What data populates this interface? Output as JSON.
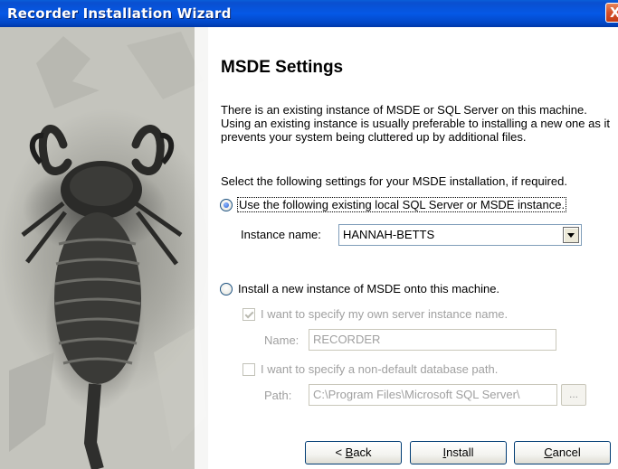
{
  "window": {
    "title": "Recorder Installation Wizard",
    "close_glyph": "X"
  },
  "page": {
    "heading": "MSDE Settings",
    "description": "There is an existing instance of MSDE or SQL Server on this machine.  Using an existing instance is usually preferable to installing a new one as it prevents your system being cluttered up by additional files.",
    "select_prompt": "Select the following settings for your MSDE installation, if required."
  },
  "option_existing": {
    "label": "Use the following existing local SQL Server or MSDE instance.",
    "selected": true,
    "instance_label": "Instance name:",
    "instance_value": "HANNAH-BETTS"
  },
  "option_new": {
    "label": "Install a new instance of MSDE onto this machine.",
    "selected": false,
    "specify_name_label": "I want to specify my own server instance name.",
    "specify_name_checked": true,
    "name_label": "Name:",
    "name_value": "RECORDER",
    "specify_path_label": "I want to specify a non-default database path.",
    "specify_path_checked": false,
    "path_label": "Path:",
    "path_value": "C:\\Program Files\\Microsoft SQL Server\\",
    "browse_label": "..."
  },
  "buttons": {
    "back_mnemonic": "B",
    "back_rest": "ack",
    "back_prefix": "< ",
    "install_mnemonic": "I",
    "install_rest": "nstall",
    "cancel_mnemonic": "C",
    "cancel_rest": "ancel"
  },
  "icons": {
    "close": "close-icon",
    "dropdown": "chevron-down-icon",
    "side_art": "scorpion-illustration"
  },
  "colors": {
    "titlebar": "#0558e6",
    "close_button": "#d4502a",
    "disabled_text": "#a0a0a0"
  }
}
